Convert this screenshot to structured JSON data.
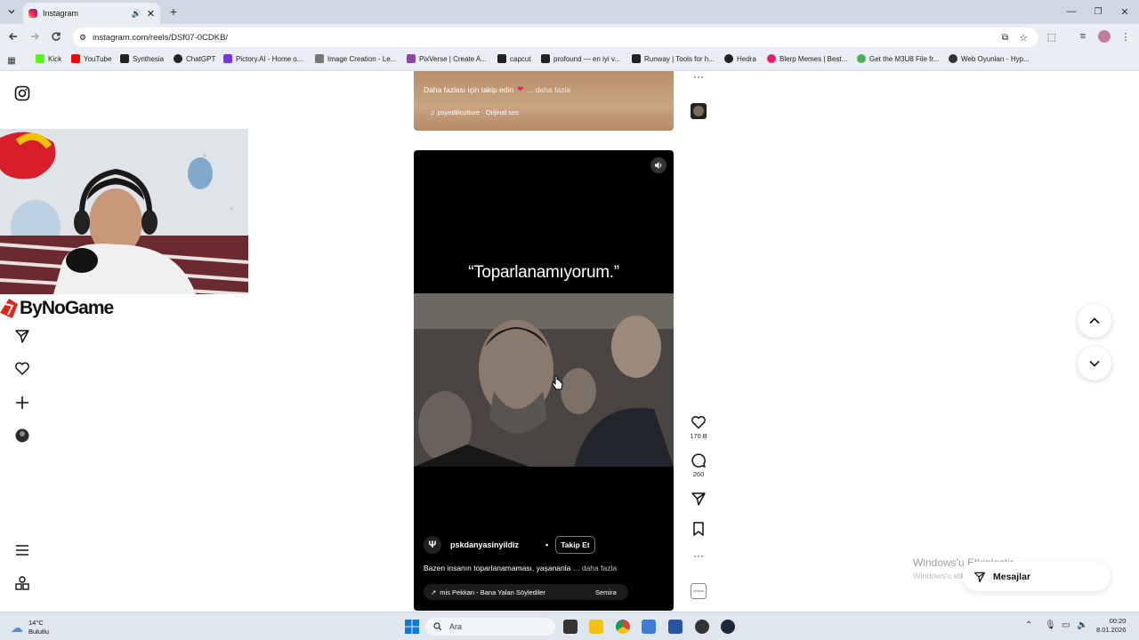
{
  "browser": {
    "tab_title": "Instagram",
    "url": "instagram.com/reels/DSf07-0CDKB/",
    "bookmarks": [
      {
        "label": "Kick",
        "color": "#53fc18"
      },
      {
        "label": "YouTube",
        "color": "#ff0000"
      },
      {
        "label": "Synthesia",
        "color": "#222222"
      },
      {
        "label": "ChatGPT",
        "color": "#222222"
      },
      {
        "label": "Pictory.AI - Home o...",
        "color": "#7b2ff7"
      },
      {
        "label": "Image Creation - Le...",
        "color": "#555555"
      },
      {
        "label": "PixVerse | Create A...",
        "color": "#8e44ad"
      },
      {
        "label": "capcut",
        "color": "#222222"
      },
      {
        "label": "profound — en iyi v...",
        "color": "#222222"
      },
      {
        "label": "Runway | Tools for h...",
        "color": "#222222"
      },
      {
        "label": "Hedra",
        "color": "#222222"
      },
      {
        "label": "Blerp Memes | Best...",
        "color": "#e91e63"
      },
      {
        "label": "Get the M3U8 File fr...",
        "color": "#4caf50"
      },
      {
        "label": "Web Oyunları - Hyp...",
        "color": "#333333"
      }
    ]
  },
  "overlay": {
    "brand": "ByNoGame"
  },
  "prev_reel": {
    "caption": "Daha fazlası için takip edin",
    "more": "... daha fazla",
    "audio": "psyediliculture · Orijinal ses"
  },
  "reel": {
    "quote": "“Toparlanamıyorum.”",
    "username": "pskdanyasinyildiz",
    "dot": "•",
    "follow_label": "Takip Et",
    "caption": "Bazen insanın toparlanamaması, yaşananla",
    "more": "... daha fazla",
    "audio": "mis Pekkan - Bana Yalan Söylediler",
    "audio_right": "Semira"
  },
  "actions": {
    "likes": "170 B",
    "comments": "260"
  },
  "windows": {
    "watermark_title": "Windows'u Etkinleştir",
    "watermark_sub": "Windows'u etkinleştirmek için Ayarlar'a gidin."
  },
  "messages_label": "Mesajlar",
  "taskbar": {
    "weather_temp": "14°C",
    "weather_desc": "Bulutlu",
    "search_placeholder": "Ara",
    "time": "00:20",
    "date": "8.01.2026"
  }
}
